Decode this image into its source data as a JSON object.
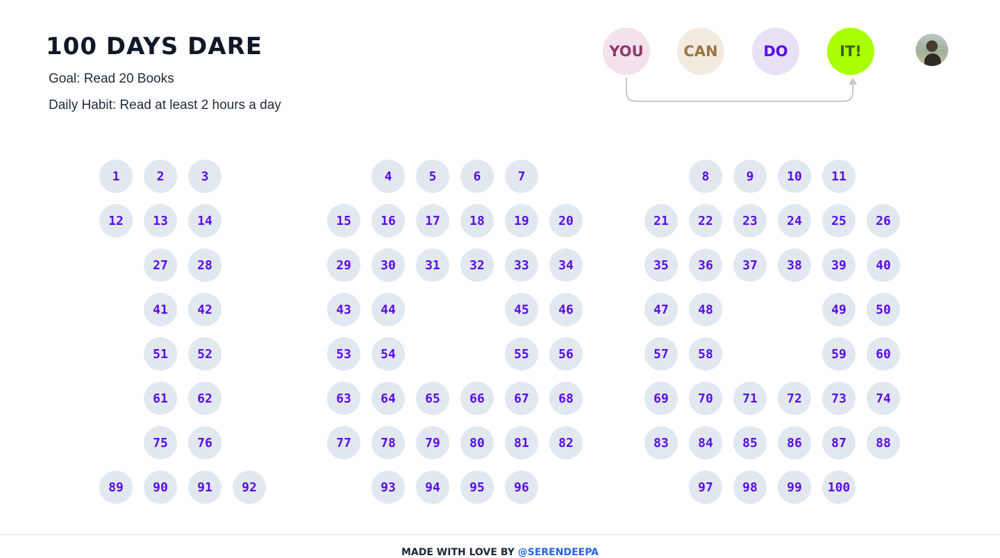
{
  "header": {
    "title": "100 DAYS DARE",
    "goal": "Goal: Read 20 Books",
    "habit": "Daily Habit: Read at least 2 hours a day"
  },
  "motto": [
    {
      "text": "YOU",
      "bg": "#f3e1ec",
      "fg": "#8b3a6e"
    },
    {
      "text": "CAN",
      "bg": "#f3ebe1",
      "fg": "#9a7640"
    },
    {
      "text": "DO",
      "bg": "#e8e0f5",
      "fg": "#5a0de8"
    },
    {
      "text": "IT!",
      "bg": "#aaff00",
      "fg": "#3f5f1a"
    }
  ],
  "avatar": {
    "icon": "user-avatar-photo"
  },
  "days": [
    "1",
    "2",
    "3",
    "4",
    "5",
    "6",
    "7",
    "8",
    "9",
    "10",
    "11",
    "12",
    "13",
    "14",
    "15",
    "16",
    "17",
    "18",
    "19",
    "20",
    "21",
    "22",
    "23",
    "24",
    "25",
    "26",
    "27",
    "28",
    "29",
    "30",
    "31",
    "32",
    "33",
    "34",
    "35",
    "36",
    "37",
    "38",
    "39",
    "40",
    "41",
    "42",
    "43",
    "44",
    "45",
    "46",
    "47",
    "48",
    "49",
    "50",
    "51",
    "52",
    "53",
    "54",
    "55",
    "56",
    "57",
    "58",
    "59",
    "60",
    "61",
    "62",
    "63",
    "64",
    "65",
    "66",
    "67",
    "68",
    "69",
    "70",
    "71",
    "72",
    "73",
    "74",
    "75",
    "76",
    "77",
    "78",
    "79",
    "80",
    "81",
    "82",
    "83",
    "84",
    "85",
    "86",
    "87",
    "88",
    "89",
    "90",
    "91",
    "92",
    "93",
    "94",
    "95",
    "96",
    "97",
    "98",
    "99",
    "100"
  ],
  "colors": {
    "circle_bg": "#e2e8f0",
    "circle_text": "#5a0de8",
    "accent_link": "#2563eb"
  },
  "footer": {
    "prefix": "MADE WITH LOVE BY",
    "link": "@SERENDEEPA"
  }
}
